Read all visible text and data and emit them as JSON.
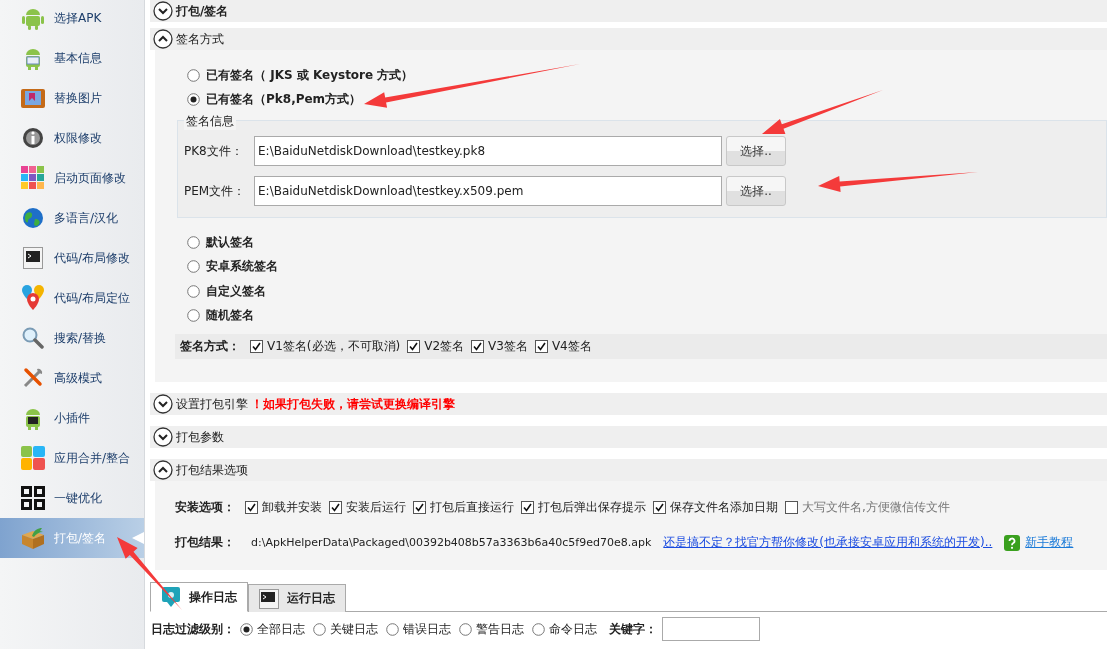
{
  "sidebar": {
    "items": [
      {
        "label": "选择APK",
        "selected": false
      },
      {
        "label": "基本信息",
        "selected": false
      },
      {
        "label": "替换图片",
        "selected": false
      },
      {
        "label": "权限修改",
        "selected": false
      },
      {
        "label": "启动页面修改",
        "selected": false
      },
      {
        "label": "多语言/汉化",
        "selected": false
      },
      {
        "label": "代码/布局修改",
        "selected": false
      },
      {
        "label": "代码/布局定位",
        "selected": false
      },
      {
        "label": "搜索/替换",
        "selected": false
      },
      {
        "label": "高级模式",
        "selected": false
      },
      {
        "label": "小插件",
        "selected": false
      },
      {
        "label": "应用合并/整合",
        "selected": false
      },
      {
        "label": "一键优化",
        "selected": false
      },
      {
        "label": "打包/签名",
        "selected": true
      }
    ]
  },
  "sections": [
    {
      "title": "打包/签名",
      "expanded": false
    },
    {
      "title": "签名方式",
      "expanded": true,
      "kind": "signing"
    },
    {
      "title": "设置打包引擎",
      "warning": "！如果打包失败，请尝试更换编译引擎",
      "expanded": false
    },
    {
      "title": "打包参数",
      "expanded": false
    },
    {
      "title": "打包结果选项",
      "expanded": true,
      "kind": "result"
    }
  ],
  "signing": {
    "options_before": [
      {
        "label": "已有签名（ JKS 或 Keystore 方式）",
        "selected": false
      },
      {
        "label": "已有签名（Pk8,Pem方式）",
        "selected": true
      }
    ],
    "sign_info": {
      "title": "签名信息",
      "fields": [
        {
          "label": "PK8文件：",
          "value": "E:\\BaiduNetdiskDownload\\testkey.pk8",
          "button": "选择.."
        },
        {
          "label": "PEM文件：",
          "value": "E:\\BaiduNetdiskDownload\\testkey.x509.pem",
          "button": "选择.."
        }
      ]
    },
    "options_after": [
      {
        "label": "默认签名",
        "selected": false
      },
      {
        "label": "安卓系统签名",
        "selected": false
      },
      {
        "label": "自定义签名",
        "selected": false
      },
      {
        "label": "随机签名",
        "selected": false
      }
    ],
    "schemes": {
      "label": "签名方式：",
      "items": [
        {
          "label": "V1签名(必选，不可取消)",
          "checked": true
        },
        {
          "label": "V2签名",
          "checked": true
        },
        {
          "label": "V3签名",
          "checked": true
        },
        {
          "label": "V4签名",
          "checked": true
        }
      ]
    }
  },
  "result": {
    "install": {
      "label": "安装选项：",
      "items": [
        {
          "label": "卸载并安装",
          "checked": true
        },
        {
          "label": "安装后运行",
          "checked": true
        },
        {
          "label": "打包后直接运行",
          "checked": true
        },
        {
          "label": "打包后弹出保存提示",
          "checked": true
        },
        {
          "label": "保存文件名添加日期",
          "checked": true
        },
        {
          "label": "大写文件名,方便微信传文件",
          "checked": false
        }
      ]
    },
    "output": {
      "label": "打包结果：",
      "path": "d:\\ApkHelperData\\Packaged\\00392b408b57a3363b6a40c5f9ed70e8.apk",
      "link": "还是搞不定？找官方帮你修改(也承接安卓应用和系统的开发)..",
      "help": "新手教程"
    }
  },
  "log": {
    "tabs": [
      {
        "label": "操作日志",
        "selected": true
      },
      {
        "label": "运行日志",
        "selected": false
      }
    ],
    "filter": {
      "label": "日志过滤级别：",
      "levels": [
        {
          "label": "全部日志",
          "selected": true
        },
        {
          "label": "关键日志",
          "selected": false
        },
        {
          "label": "错误日志",
          "selected": false
        },
        {
          "label": "警告日志",
          "selected": false
        },
        {
          "label": "命令日志",
          "selected": false
        }
      ],
      "keyword_label": "关键字："
    }
  }
}
